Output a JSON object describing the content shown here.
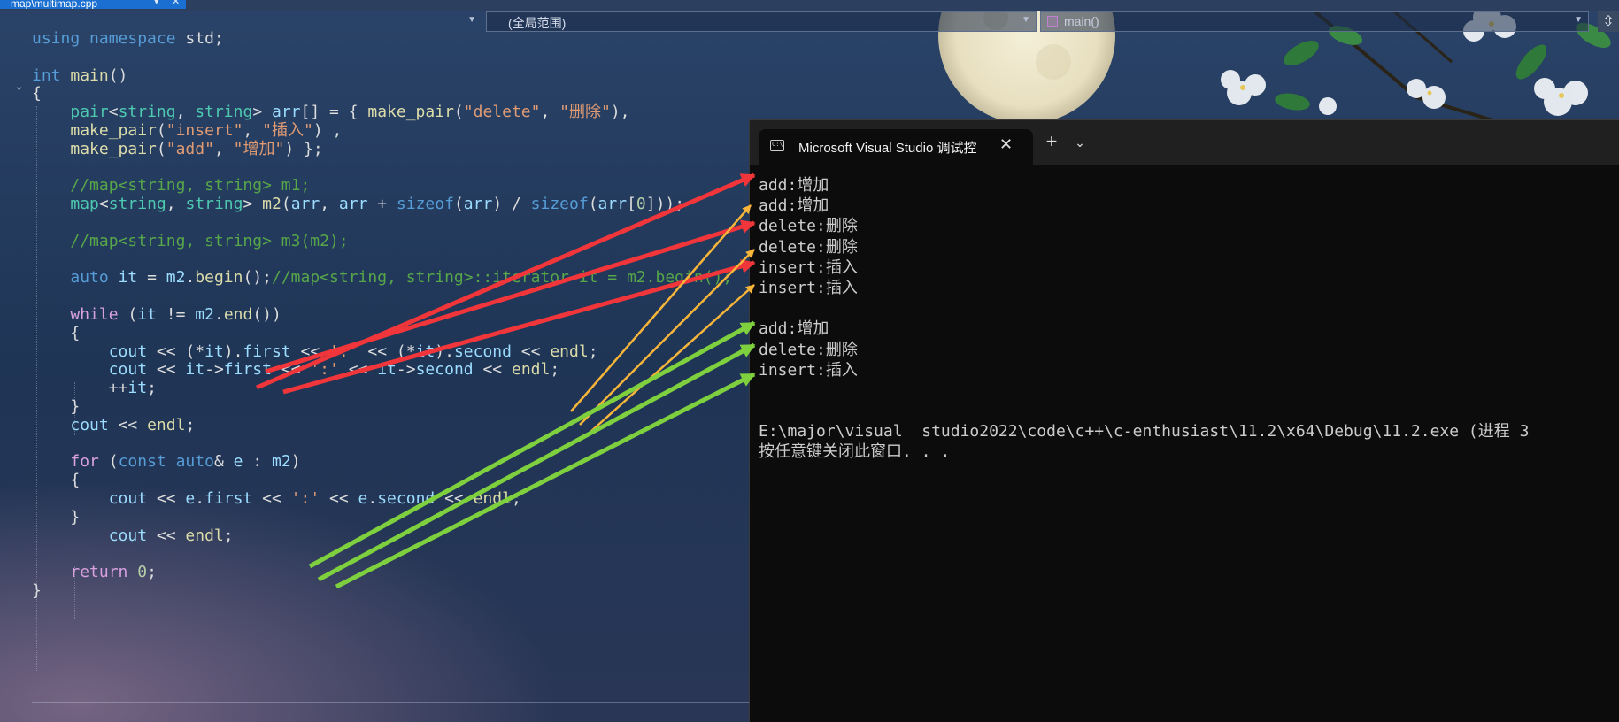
{
  "tab": {
    "filename": "map\\multimap.cpp"
  },
  "navbar": {
    "scope_label": "(全局范围)",
    "function_label": "main()"
  },
  "code_lines": [
    {
      "segments": [
        [
          "k",
          "using"
        ],
        [
          "p",
          " "
        ],
        [
          "k",
          "namespace"
        ],
        [
          "p",
          " std;"
        ]
      ]
    },
    {
      "segments": []
    },
    {
      "segments": [
        [
          "k",
          "int"
        ],
        [
          "p",
          " "
        ],
        [
          "f",
          "main"
        ],
        [
          "p",
          "()"
        ]
      ]
    },
    {
      "segments": [
        [
          "p",
          "{"
        ]
      ]
    },
    {
      "segments": [
        [
          "p",
          "    "
        ],
        [
          "t",
          "pair"
        ],
        [
          "p",
          "<"
        ],
        [
          "t",
          "string"
        ],
        [
          "p",
          ", "
        ],
        [
          "t",
          "string"
        ],
        [
          "p",
          "> "
        ],
        [
          "v",
          "arr"
        ],
        [
          "p",
          "[] = { "
        ],
        [
          "f",
          "make_pair"
        ],
        [
          "p",
          "("
        ],
        [
          "s",
          "\"delete\""
        ],
        [
          "p",
          ", "
        ],
        [
          "s",
          "\"删除\""
        ],
        [
          "p",
          "),"
        ]
      ]
    },
    {
      "segments": [
        [
          "p",
          "    "
        ],
        [
          "f",
          "make_pair"
        ],
        [
          "p",
          "("
        ],
        [
          "s",
          "\"insert\""
        ],
        [
          "p",
          ", "
        ],
        [
          "s",
          "\"插入\""
        ],
        [
          "p",
          ") ,"
        ]
      ]
    },
    {
      "segments": [
        [
          "p",
          "    "
        ],
        [
          "f",
          "make_pair"
        ],
        [
          "p",
          "("
        ],
        [
          "s",
          "\"add\""
        ],
        [
          "p",
          ", "
        ],
        [
          "s",
          "\"增加\""
        ],
        [
          "p",
          ") };"
        ]
      ]
    },
    {
      "segments": []
    },
    {
      "segments": [
        [
          "p",
          "    "
        ],
        [
          "c",
          "//map<string, string> m1;"
        ]
      ]
    },
    {
      "segments": [
        [
          "p",
          "    "
        ],
        [
          "t",
          "map"
        ],
        [
          "p",
          "<"
        ],
        [
          "t",
          "string"
        ],
        [
          "p",
          ", "
        ],
        [
          "t",
          "string"
        ],
        [
          "p",
          "> "
        ],
        [
          "f",
          "m2"
        ],
        [
          "p",
          "("
        ],
        [
          "v",
          "arr"
        ],
        [
          "p",
          ", "
        ],
        [
          "v",
          "arr"
        ],
        [
          "p",
          " + "
        ],
        [
          "k",
          "sizeof"
        ],
        [
          "p",
          "("
        ],
        [
          "v",
          "arr"
        ],
        [
          "p",
          ") / "
        ],
        [
          "k",
          "sizeof"
        ],
        [
          "p",
          "("
        ],
        [
          "v",
          "arr"
        ],
        [
          "p",
          "["
        ],
        [
          "n",
          "0"
        ],
        [
          "p",
          "]));"
        ]
      ]
    },
    {
      "segments": []
    },
    {
      "segments": [
        [
          "p",
          "    "
        ],
        [
          "c",
          "//map<string, string> m3(m2);"
        ]
      ]
    },
    {
      "segments": []
    },
    {
      "segments": [
        [
          "p",
          "    "
        ],
        [
          "k",
          "auto"
        ],
        [
          "p",
          " "
        ],
        [
          "v",
          "it"
        ],
        [
          "p",
          " = "
        ],
        [
          "v",
          "m2"
        ],
        [
          "p",
          "."
        ],
        [
          "f",
          "begin"
        ],
        [
          "p",
          "();"
        ],
        [
          "c",
          "//map<string, string>::iterator it = m2.begin();"
        ]
      ]
    },
    {
      "segments": []
    },
    {
      "segments": [
        [
          "p",
          "    "
        ],
        [
          "ctl",
          "while"
        ],
        [
          "p",
          " ("
        ],
        [
          "v",
          "it"
        ],
        [
          "p",
          " != "
        ],
        [
          "v",
          "m2"
        ],
        [
          "p",
          "."
        ],
        [
          "f",
          "end"
        ],
        [
          "p",
          "())"
        ]
      ]
    },
    {
      "segments": [
        [
          "p",
          "    {"
        ]
      ]
    },
    {
      "segments": [
        [
          "p",
          "        "
        ],
        [
          "v",
          "cout"
        ],
        [
          "p",
          " << (*"
        ],
        [
          "v",
          "it"
        ],
        [
          "p",
          ")."
        ],
        [
          "v",
          "first"
        ],
        [
          "p",
          " << "
        ],
        [
          "s",
          "':'"
        ],
        [
          "p",
          " << (*"
        ],
        [
          "v",
          "it"
        ],
        [
          "p",
          ")."
        ],
        [
          "v",
          "second"
        ],
        [
          "p",
          " << "
        ],
        [
          "f",
          "endl"
        ],
        [
          "p",
          ";"
        ]
      ]
    },
    {
      "segments": [
        [
          "p",
          "        "
        ],
        [
          "v",
          "cout"
        ],
        [
          "p",
          " << "
        ],
        [
          "v",
          "it"
        ],
        [
          "p",
          "->"
        ],
        [
          "v",
          "first"
        ],
        [
          "p",
          " << "
        ],
        [
          "s",
          "':'"
        ],
        [
          "p",
          " << "
        ],
        [
          "v",
          "it"
        ],
        [
          "p",
          "->"
        ],
        [
          "v",
          "second"
        ],
        [
          "p",
          " << "
        ],
        [
          "f",
          "endl"
        ],
        [
          "p",
          ";"
        ]
      ]
    },
    {
      "segments": [
        [
          "p",
          "        ++"
        ],
        [
          "v",
          "it"
        ],
        [
          "p",
          ";"
        ]
      ]
    },
    {
      "segments": [
        [
          "p",
          "    }"
        ]
      ]
    },
    {
      "segments": [
        [
          "p",
          "    "
        ],
        [
          "v",
          "cout"
        ],
        [
          "p",
          " << "
        ],
        [
          "f",
          "endl"
        ],
        [
          "p",
          ";"
        ]
      ]
    },
    {
      "segments": []
    },
    {
      "segments": [
        [
          "p",
          "    "
        ],
        [
          "ctl",
          "for"
        ],
        [
          "p",
          " ("
        ],
        [
          "k",
          "const"
        ],
        [
          "p",
          " "
        ],
        [
          "k",
          "auto"
        ],
        [
          "p",
          "& "
        ],
        [
          "v",
          "e"
        ],
        [
          "p",
          " : "
        ],
        [
          "v",
          "m2"
        ],
        [
          "p",
          ")"
        ]
      ]
    },
    {
      "segments": [
        [
          "p",
          "    {"
        ]
      ]
    },
    {
      "segments": [
        [
          "p",
          "        "
        ],
        [
          "v",
          "cout"
        ],
        [
          "p",
          " << "
        ],
        [
          "v",
          "e"
        ],
        [
          "p",
          "."
        ],
        [
          "v",
          "first"
        ],
        [
          "p",
          " << "
        ],
        [
          "s",
          "':'"
        ],
        [
          "p",
          " << "
        ],
        [
          "v",
          "e"
        ],
        [
          "p",
          "."
        ],
        [
          "v",
          "second"
        ],
        [
          "p",
          " << "
        ],
        [
          "f",
          "endl"
        ],
        [
          "p",
          ";"
        ]
      ]
    },
    {
      "segments": [
        [
          "p",
          "    }"
        ]
      ]
    },
    {
      "segments": [
        [
          "p",
          "        "
        ],
        [
          "v",
          "cout"
        ],
        [
          "p",
          " << "
        ],
        [
          "f",
          "endl"
        ],
        [
          "p",
          ";"
        ]
      ]
    },
    {
      "segments": []
    },
    {
      "segments": [
        [
          "p",
          "    "
        ],
        [
          "ctl",
          "return"
        ],
        [
          "p",
          " "
        ],
        [
          "n",
          "0"
        ],
        [
          "p",
          ";"
        ]
      ]
    },
    {
      "segments": [
        [
          "p",
          "}"
        ]
      ]
    }
  ],
  "terminal": {
    "title": "Microsoft Visual Studio 调试控",
    "new_tab": "+",
    "dropdown": "⌄",
    "output_lines": [
      "add:增加",
      "add:增加",
      "delete:删除",
      "delete:删除",
      "insert:插入",
      "insert:插入",
      "",
      "add:增加",
      "delete:删除",
      "insert:插入",
      "",
      "",
      "E:\\major\\visual  studio2022\\code\\c++\\c-enthusiast\\11.2\\x64\\Debug\\11.2.exe (进程 3",
      "按任意键关闭此窗口. . ."
    ]
  },
  "colors": {
    "arrow_red": "#f0363a",
    "arrow_orange": "#f7b53a",
    "arrow_green": "#7ed03e",
    "terminal_bg": "#0c0c0c",
    "tab_accent": "#1a6fd0"
  },
  "icons": [
    "app-console-icon",
    "close-icon",
    "plus-icon",
    "chevron-down-icon",
    "function-cube-icon",
    "split-icon",
    "pin-icon"
  ]
}
